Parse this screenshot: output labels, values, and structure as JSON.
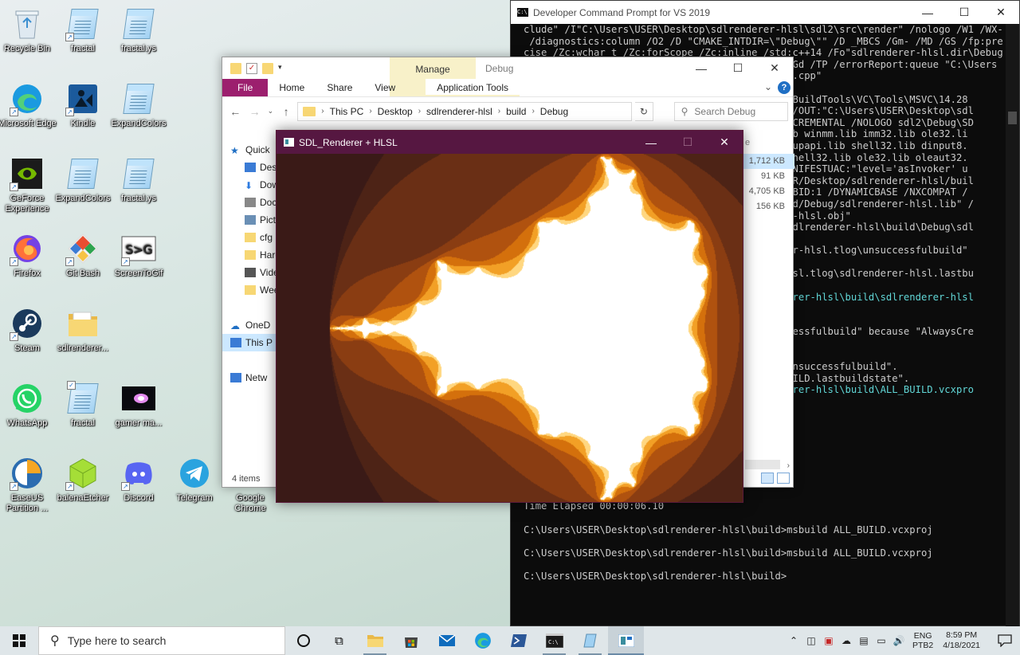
{
  "desktop": {
    "icons": [
      {
        "label": "Recycle Bin"
      },
      {
        "label": "fractal"
      },
      {
        "label": "fractal.ys"
      },
      {
        "label": "Microsoft Edge"
      },
      {
        "label": "Kindle"
      },
      {
        "label": "ExpandColors"
      },
      {
        "label": "GeForce Experience"
      },
      {
        "label": "ExpandColors"
      },
      {
        "label": "fractal.ys"
      },
      {
        "label": "Firefox"
      },
      {
        "label": "Git Bash"
      },
      {
        "label": "ScreenToGif"
      },
      {
        "label": "Steam"
      },
      {
        "label": "sdlrenderer..."
      },
      {
        "label": "WhatsApp"
      },
      {
        "label": "fractal"
      },
      {
        "label": "gamer ma..."
      },
      {
        "label": "EaseUS Partition ..."
      },
      {
        "label": "balenaEtcher"
      },
      {
        "label": "Discord"
      },
      {
        "label": "Telegram"
      },
      {
        "label": "Google Chrome"
      }
    ]
  },
  "cmd": {
    "title": "Developer Command Prompt for VS 2019",
    "lines": [
      {
        "t": "clude\" /I\"C:\\Users\\USER\\Desktop\\sdlrenderer-hlsl\\sdl2\\src\\render\" /nologo /W1 /WX-",
        "c": ""
      },
      {
        "t": " /diagnostics:column /O2 /D \"CMAKE_INTDIR=\\\"Debug\\\"\" /D _MBCS /Gm- /MD /GS /fp:pre",
        "c": ""
      },
      {
        "t": "cise /Zc:wchar_t /Zc:forScope /Zc:inline /std:c++14 /Fo\"sdlrenderer-hlsl.dir\\Debug",
        "c": ""
      },
      {
        "t": "                                             /Gd /TP /errorReport:queue \"C:\\Users",
        "c": ""
      },
      {
        "t": "                                              .cpp\"",
        "c": ""
      },
      {
        "t": "",
        "c": ""
      },
      {
        "t": "                                         2019\\BuildTools\\VC\\Tools\\MSVC\\14.28",
        "c": ""
      },
      {
        "t": "                                         UEUE /OUT:\"C:\\Users\\USER\\Desktop\\sdl",
        "c": ""
      },
      {
        "t": "                                         \" /INCREMENTAL /NOLOGO sdl2\\Debug\\SD",
        "c": ""
      },
      {
        "t": "                                         32.lib winmm.lib imm32.lib ole32.li",
        "c": ""
      },
      {
        "t": "                                         b setupapi.lib shell32.lib dinput8.",
        "c": ""
      },
      {
        "t": "                                         lib shell32.lib ole32.lib oleaut32.",
        "c": ""
      },
      {
        "t": "                                         T /MANIFESTUAC:\"level='asInvoker' u",
        "c": ""
      },
      {
        "t": "                                         s/USER/Desktop/sdlrenderer-hlsl/buil",
        "c": ""
      },
      {
        "t": "                                         S /TLBID:1 /DYNAMICBASE /NXCOMPAT /",
        "c": ""
      },
      {
        "t": "                                         /build/Debug/sdlrenderer-hlsl.lib\" /",
        "c": ""
      },
      {
        "t": "                                         derer-hlsl.obj\"",
        "c": ""
      },
      {
        "t": "                                         top\\sdlrenderer-hlsl\\build\\Debug\\sdl",
        "c": ""
      },
      {
        "t": "",
        "c": ""
      },
      {
        "t": "                                         nderer-hlsl.tlog\\unsuccessfulbuild\"",
        "c": ""
      },
      {
        "t": "",
        "c": ""
      },
      {
        "t": "                                         er-hlsl.tlog\\sdlrenderer-hlsl.lastbu",
        "c": ""
      },
      {
        "t": "",
        "c": ""
      },
      {
        "t": "                                         renderer-hlsl\\build\\sdlrenderer-hlsl",
        "c": "teal"
      },
      {
        "t": "",
        "c": ""
      },
      {
        "t": "",
        "c": ""
      },
      {
        "t": "                                         nsuccessfulbuild\" because \"AlwaysCre",
        "c": ""
      },
      {
        "t": "",
        "c": ""
      },
      {
        "t": "",
        "c": ""
      },
      {
        "t": "                                         log\\unsuccessfulbuild\".",
        "c": ""
      },
      {
        "t": "                                         LL_BUILD.lastbuildstate\".",
        "c": ""
      },
      {
        "t": "                                         renderer-hlsl\\build\\ALL_BUILD.vcxpro",
        "c": "teal"
      },
      {
        "t": "",
        "c": ""
      },
      {
        "t": "",
        "c": ""
      },
      {
        "t": "",
        "c": ""
      },
      {
        "t": "",
        "c": ""
      },
      {
        "t": "",
        "c": ""
      },
      {
        "t": "",
        "c": ""
      },
      {
        "t": "    0 Warning(s)",
        "c": ""
      },
      {
        "t": "    0 Error(s)",
        "c": ""
      },
      {
        "t": "",
        "c": ""
      },
      {
        "t": "Time Elapsed 00:00:06.10",
        "c": ""
      },
      {
        "t": "",
        "c": ""
      },
      {
        "t": "C:\\Users\\USER\\Desktop\\sdlrenderer-hlsl\\build>msbuild ALL_BUILD.vcxproj",
        "c": ""
      },
      {
        "t": "",
        "c": ""
      },
      {
        "t": "C:\\Users\\USER\\Desktop\\sdlrenderer-hlsl\\build>msbuild ALL_BUILD.vcxproj",
        "c": ""
      },
      {
        "t": "",
        "c": ""
      },
      {
        "t": "C:\\Users\\USER\\Desktop\\sdlrenderer-hlsl\\build>",
        "c": ""
      }
    ]
  },
  "explorer": {
    "manage_label": "Manage",
    "title": "Debug",
    "tabs": {
      "file": "File",
      "home": "Home",
      "share": "Share",
      "view": "View",
      "apptools": "Application Tools"
    },
    "breadcrumb": [
      "This PC",
      "Desktop",
      "sdlrenderer-hlsl",
      "build",
      "Debug"
    ],
    "search_placeholder": "Search Debug",
    "nav": [
      {
        "label": "Quick",
        "icon": "star-icon",
        "indent": false
      },
      {
        "label": "Desk",
        "icon": "desktop-folder-icon",
        "indent": true
      },
      {
        "label": "Dow",
        "icon": "download-icon",
        "indent": true
      },
      {
        "label": "Doc",
        "icon": "documents-icon",
        "indent": true
      },
      {
        "label": "Pict",
        "icon": "pictures-icon",
        "indent": true
      },
      {
        "label": "cfg",
        "icon": "folder-icon",
        "indent": true
      },
      {
        "label": "Hard",
        "icon": "folder-icon",
        "indent": true
      },
      {
        "label": "Vide",
        "icon": "videos-icon",
        "indent": true
      },
      {
        "label": "Wee",
        "icon": "folder-icon",
        "indent": true
      },
      {
        "label": "",
        "icon": "",
        "indent": false
      },
      {
        "label": "OneD",
        "icon": "onedrive-icon",
        "indent": false
      },
      {
        "label": "This P",
        "icon": "this-pc-icon",
        "indent": false,
        "selected": true
      },
      {
        "label": "",
        "icon": "",
        "indent": false
      },
      {
        "label": "Netw",
        "icon": "network-icon",
        "indent": false
      }
    ],
    "column_header": "e",
    "sizes": [
      "1,712 KB",
      "91 KB",
      "4,705 KB",
      "156 KB"
    ],
    "status": "4 items"
  },
  "sdl": {
    "title": "SDL_Renderer + HLSL",
    "palette": [
      "#2a1415",
      "#3a1a17",
      "#4d2316",
      "#6a2f15",
      "#8a3d12",
      "#b0520f",
      "#d4700c",
      "#f2a026",
      "#ffd780",
      "#ffffff"
    ]
  },
  "taskbar": {
    "search_placeholder": "Type here to search",
    "language": "ENG",
    "layout": "PTB2",
    "time": "8:59 PM",
    "date": "4/18/2021"
  }
}
